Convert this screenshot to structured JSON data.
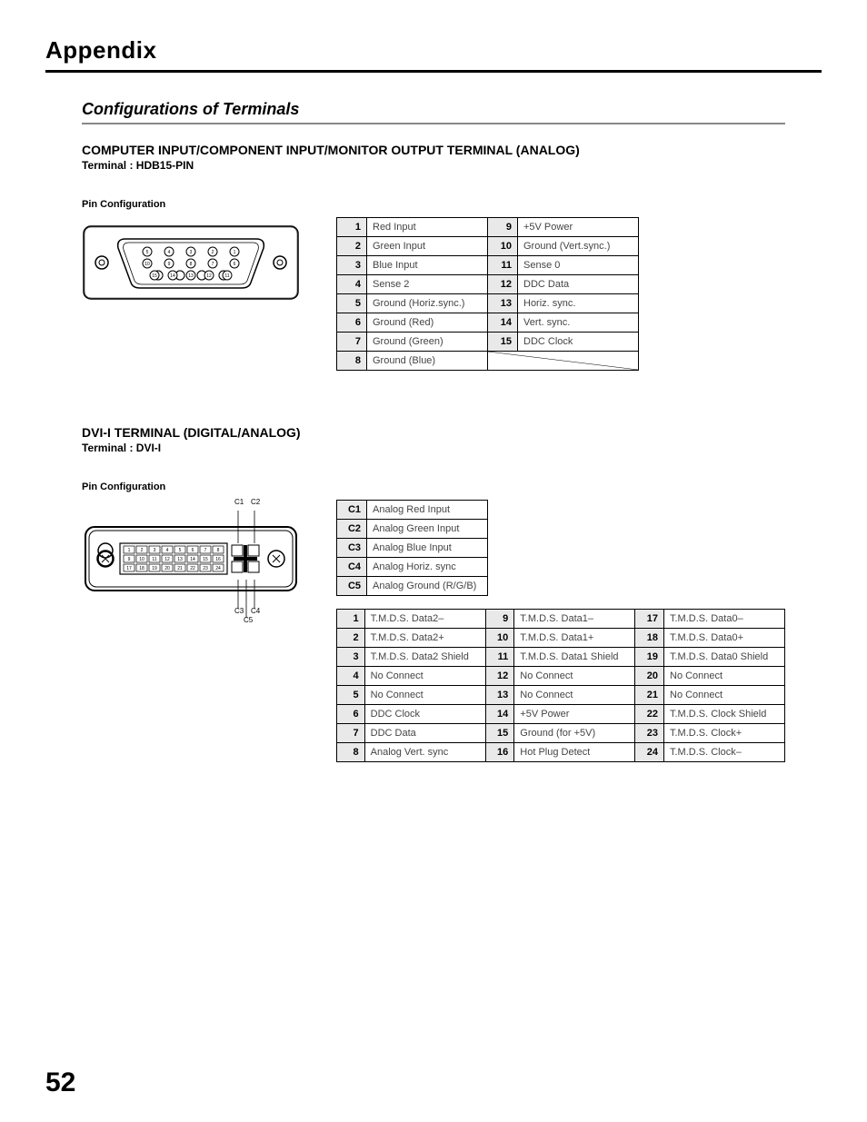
{
  "chapter": "Appendix",
  "section_title": "Configurations of Terminals",
  "hdb15": {
    "heading": "COMPUTER INPUT/COMPONENT INPUT/MONITOR OUTPUT TERMINAL (ANALOG)",
    "terminal": "Terminal : HDB15-PIN",
    "pin_config_label": "Pin Configuration",
    "pins": [
      {
        "n": "1",
        "d": "Red Input"
      },
      {
        "n": "2",
        "d": "Green Input"
      },
      {
        "n": "3",
        "d": "Blue Input"
      },
      {
        "n": "4",
        "d": "Sense 2"
      },
      {
        "n": "5",
        "d": "Ground (Horiz.sync.)"
      },
      {
        "n": "6",
        "d": "Ground (Red)"
      },
      {
        "n": "7",
        "d": "Ground (Green)"
      },
      {
        "n": "8",
        "d": "Ground (Blue)"
      },
      {
        "n": "9",
        "d": "+5V Power"
      },
      {
        "n": "10",
        "d": "Ground (Vert.sync.)"
      },
      {
        "n": "11",
        "d": "Sense 0"
      },
      {
        "n": "12",
        "d": "DDC Data"
      },
      {
        "n": "13",
        "d": "Horiz. sync."
      },
      {
        "n": "14",
        "d": "Vert. sync."
      },
      {
        "n": "15",
        "d": "DDC Clock"
      }
    ]
  },
  "dvi": {
    "heading": "DVI-I TERMINAL (DIGITAL/ANALOG)",
    "terminal": "Terminal : DVI-I",
    "pin_config_label": "Pin Configuration",
    "caps": {
      "c1": "C1",
      "c2": "C2",
      "c3": "C3",
      "c4": "C4",
      "c5": "C5"
    },
    "cpins": [
      {
        "n": "C1",
        "d": "Analog Red Input"
      },
      {
        "n": "C2",
        "d": "Analog Green Input"
      },
      {
        "n": "C3",
        "d": "Analog Blue Input"
      },
      {
        "n": "C4",
        "d": "Analog Horiz. sync"
      },
      {
        "n": "C5",
        "d": "Analog Ground (R/G/B)"
      }
    ],
    "pins": [
      {
        "n": "1",
        "d": "T.M.D.S. Data2–"
      },
      {
        "n": "2",
        "d": "T.M.D.S. Data2+"
      },
      {
        "n": "3",
        "d": "T.M.D.S. Data2 Shield"
      },
      {
        "n": "4",
        "d": "No Connect"
      },
      {
        "n": "5",
        "d": "No Connect"
      },
      {
        "n": "6",
        "d": "DDC Clock"
      },
      {
        "n": "7",
        "d": "DDC Data"
      },
      {
        "n": "8",
        "d": "Analog Vert. sync"
      },
      {
        "n": "9",
        "d": "T.M.D.S. Data1–"
      },
      {
        "n": "10",
        "d": "T.M.D.S. Data1+"
      },
      {
        "n": "11",
        "d": "T.M.D.S. Data1 Shield"
      },
      {
        "n": "12",
        "d": "No Connect"
      },
      {
        "n": "13",
        "d": "No Connect"
      },
      {
        "n": "14",
        "d": "+5V Power"
      },
      {
        "n": "15",
        "d": "Ground (for +5V)"
      },
      {
        "n": "16",
        "d": "Hot Plug Detect"
      },
      {
        "n": "17",
        "d": "T.M.D.S. Data0–"
      },
      {
        "n": "18",
        "d": "T.M.D.S. Data0+"
      },
      {
        "n": "19",
        "d": "T.M.D.S. Data0 Shield"
      },
      {
        "n": "20",
        "d": "No Connect"
      },
      {
        "n": "21",
        "d": "No Connect"
      },
      {
        "n": "22",
        "d": "T.M.D.S. Clock Shield"
      },
      {
        "n": "23",
        "d": "T.M.D.S. Clock+"
      },
      {
        "n": "24",
        "d": "T.M.D.S. Clock–"
      }
    ]
  },
  "page_number": "52"
}
